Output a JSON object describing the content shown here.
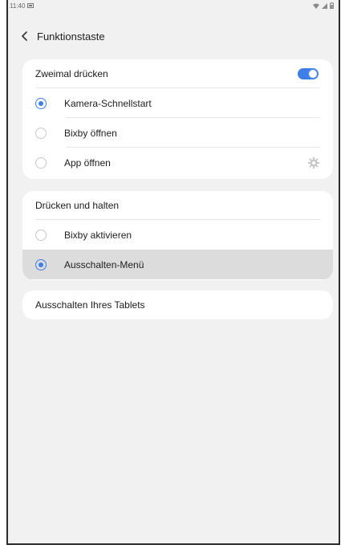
{
  "status_bar": {
    "time": "11:40",
    "notification_icon": "image-icon",
    "right_icons": "wifi signal battery"
  },
  "app_bar": {
    "back_icon": "chevron-left-icon",
    "title": "Funktionstaste"
  },
  "double_press": {
    "title": "Zweimal drücken",
    "enabled": true,
    "options": [
      {
        "label": "Kamera-Schnellstart",
        "selected": true
      },
      {
        "label": "Bixby öffnen",
        "selected": false
      },
      {
        "label": "App öffnen",
        "selected": false,
        "settings_icon": "gear-icon"
      }
    ]
  },
  "press_hold": {
    "title": "Drücken und halten",
    "options": [
      {
        "label": "Bixby aktivieren",
        "selected": false
      },
      {
        "label": "Ausschalten-Menü",
        "selected": true
      }
    ]
  },
  "power_off": {
    "label": "Ausschalten Ihres Tablets"
  },
  "colors": {
    "accent": "#3e7ee8",
    "background": "#f1f1f1",
    "card": "#ffffff",
    "selected_row": "#dcdcdc"
  }
}
